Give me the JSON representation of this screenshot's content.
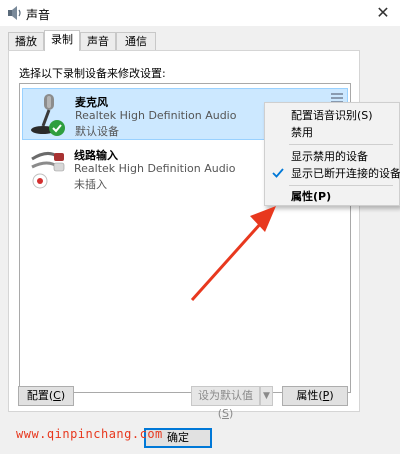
{
  "window": {
    "title": "声音",
    "close_glyph": "✕"
  },
  "tabs": [
    {
      "label": "播放",
      "active": false
    },
    {
      "label": "录制",
      "active": true
    },
    {
      "label": "声音",
      "active": false
    },
    {
      "label": "通信",
      "active": false
    }
  ],
  "instruction": "选择以下录制设备来修改设置:",
  "devices": [
    {
      "name": "麦克风",
      "driver": "Realtek High Definition Audio",
      "status": "默认设备",
      "selected": true,
      "icon": "microphone-icon",
      "badge": "default-check-icon"
    },
    {
      "name": "线路输入",
      "driver": "Realtek High Definition Audio",
      "status": "未插入",
      "selected": false,
      "icon": "line-in-cable-icon",
      "badge": "unplugged-icon"
    }
  ],
  "buttons": {
    "configure": {
      "label": "配置",
      "accel": "C"
    },
    "set_default": {
      "label": "设为默认值",
      "accel": "S"
    },
    "properties": {
      "label": "属性",
      "accel": "P"
    },
    "ok": {
      "label": "确定"
    }
  },
  "context_menu": {
    "items": [
      {
        "label": "配置语音识别(S)",
        "bold": false,
        "checked": false
      },
      {
        "label": "禁用",
        "bold": false,
        "checked": false
      },
      {
        "label": "显示禁用的设备",
        "bold": false,
        "checked": false
      },
      {
        "label": "显示已断开连接的设备",
        "bold": false,
        "checked": true
      },
      {
        "label": "属性(P)",
        "bold": true,
        "checked": false
      }
    ]
  },
  "annotation": {
    "color": "#e8381e"
  },
  "watermark": {
    "text": "www.qinpinchang.com"
  },
  "colors": {
    "selection_bg": "#cce8ff",
    "selection_border": "#99d1ff",
    "accent": "#0078d7",
    "check_green": "#2e9e3e",
    "unplugged_red": "#d32f2f"
  }
}
